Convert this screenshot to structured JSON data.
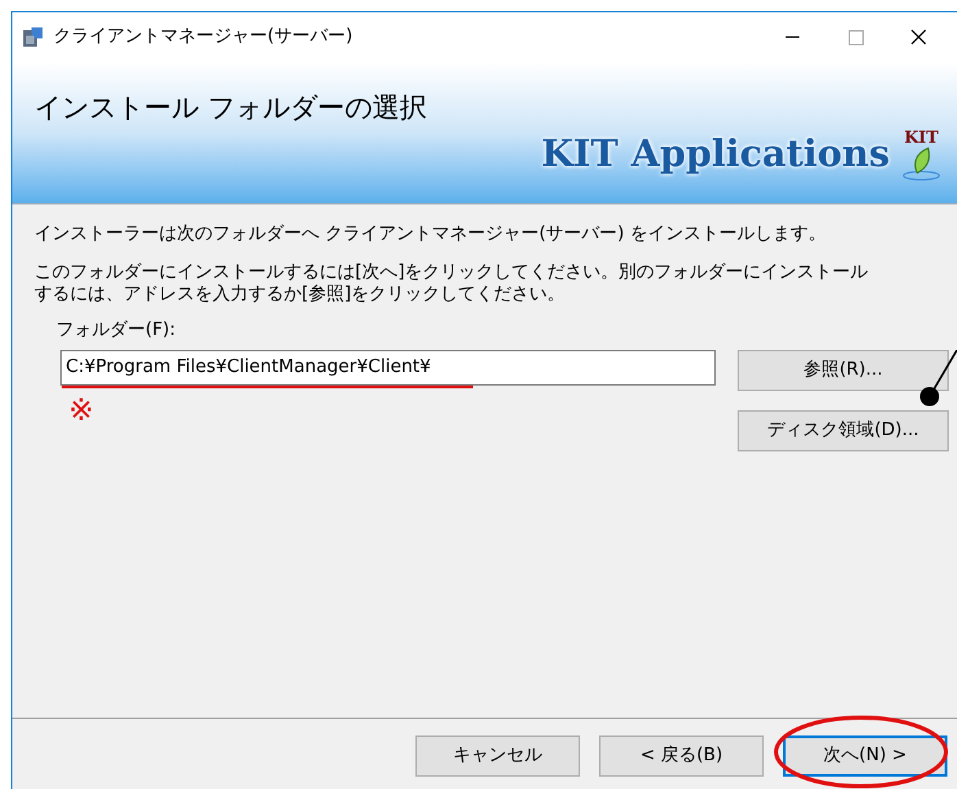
{
  "window": {
    "title": "クライアントマネージャー(サーバー)"
  },
  "banner": {
    "heading": "インストール フォルダーの選択",
    "logo_text": "KIT Applications",
    "logo_mark": "KIT"
  },
  "body": {
    "paragraphs": [
      "インストーラーは次のフォルダーへ クライアントマネージャー(サーバー) をインストールします。",
      "このフォルダーにインストールするには[次へ]をクリックしてください。別のフォルダーにインストールするには、アドレスを入力するか[参照]をクリックしてください。"
    ],
    "folder_label": "フォルダー(F):",
    "folder_value": "C:¥Program Files¥ClientManager¥Client¥",
    "note_mark": "※",
    "side_buttons": [
      "参照(R)...",
      "ディスク領域(D)..."
    ]
  },
  "buttons": [
    {
      "label": "キャンセル",
      "focused": false
    },
    {
      "label": "< 戻る(B)",
      "focused": false
    },
    {
      "label": "次へ(N) >",
      "focused": true
    }
  ]
}
